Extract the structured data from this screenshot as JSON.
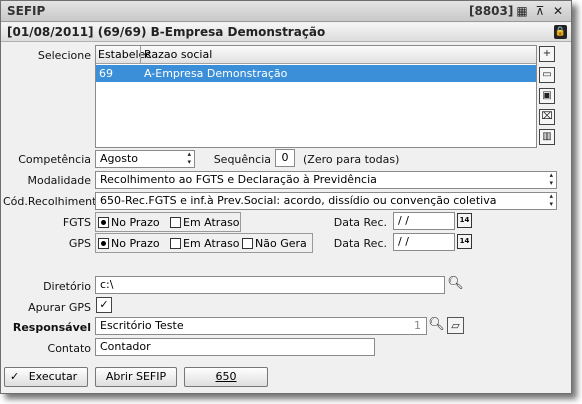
{
  "window": {
    "title": "SEFIP",
    "code": "[8803]"
  },
  "header": {
    "title": "[01/08/2011] (69/69) B-Empresa Demonstração"
  },
  "selecione": {
    "label": "Selecione",
    "columns": [
      "Estabelec",
      "Razao social"
    ],
    "rows": [
      {
        "estab": "69",
        "razao": "A-Empresa Demonstração"
      }
    ]
  },
  "competencia": {
    "label": "Competência",
    "value": "Agosto"
  },
  "sequencia": {
    "label": "Sequência",
    "value": "0",
    "hint": "(Zero para todas)"
  },
  "modalidade": {
    "label": "Modalidade",
    "value": "Recolhimento ao FGTS e Declaração à Previdência"
  },
  "cod_recolhimento": {
    "label": "Cód.Recolhimento",
    "value": "650-Rec.FGTS e inf.à Prev.Social: acordo, dissídio ou convenção coletiva"
  },
  "fgts": {
    "label": "FGTS",
    "options": [
      "No Prazo",
      "Em Atraso"
    ],
    "selected": "No Prazo",
    "data_rec_label": "Data Rec.",
    "data_rec_value": " / /"
  },
  "gps": {
    "label": "GPS",
    "options": [
      "No Prazo",
      "Em Atraso",
      "Não Gera"
    ],
    "selected": "No Prazo",
    "data_rec_label": "Data Rec.",
    "data_rec_value": " / /"
  },
  "calendar_label": "14",
  "diretorio": {
    "label": "Diretório",
    "value": "c:\\"
  },
  "apurar_gps": {
    "label": "Apurar GPS",
    "checked": true,
    "mark": "✓"
  },
  "responsavel": {
    "label": "Responsável",
    "value": "Escritório Teste",
    "code": "1"
  },
  "contato": {
    "label": "Contato",
    "value": "Contador"
  },
  "buttons": {
    "executar": "Executar",
    "executar_mark": "✓",
    "abrir": "Abrir SEFIP",
    "code": "650"
  },
  "icons": {
    "title": [
      "grid-icon",
      "pin-icon",
      "close-icon"
    ],
    "side": [
      "add-icon",
      "page-icon",
      "save-icon",
      "open-folder-icon",
      "delete-icon"
    ]
  }
}
